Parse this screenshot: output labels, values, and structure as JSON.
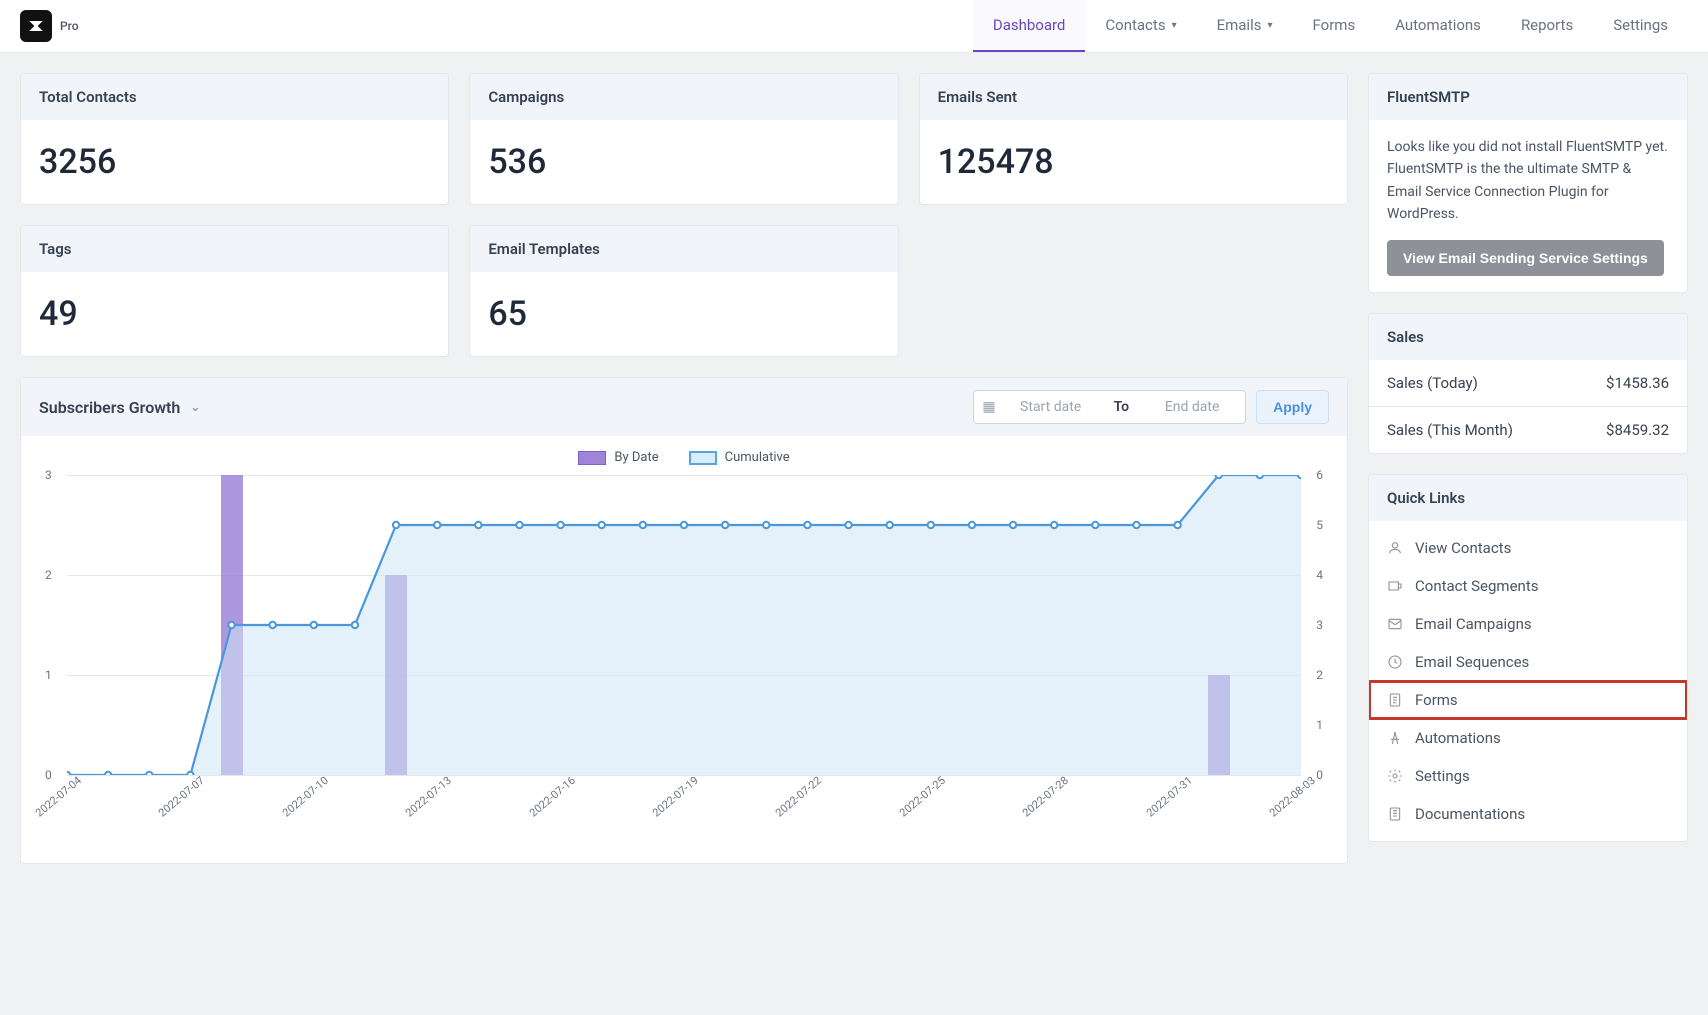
{
  "brand": {
    "badge": "Pro"
  },
  "nav": {
    "items": [
      {
        "label": "Dashboard",
        "active": true
      },
      {
        "label": "Contacts",
        "caret": true
      },
      {
        "label": "Emails",
        "caret": true
      },
      {
        "label": "Forms"
      },
      {
        "label": "Automations"
      },
      {
        "label": "Reports"
      },
      {
        "label": "Settings"
      }
    ]
  },
  "stats": {
    "total_contacts": {
      "label": "Total Contacts",
      "value": "3256"
    },
    "campaigns": {
      "label": "Campaigns",
      "value": "536"
    },
    "emails_sent": {
      "label": "Emails Sent",
      "value": "125478"
    },
    "tags": {
      "label": "Tags",
      "value": "49"
    },
    "email_templates": {
      "label": "Email Templates",
      "value": "65"
    }
  },
  "chart": {
    "title": "Subscribers Growth",
    "legend_bar": "By Date",
    "legend_line": "Cumulative",
    "date_start_ph": "Start date",
    "date_sep": "To",
    "date_end_ph": "End date",
    "apply": "Apply"
  },
  "fluentsmtp": {
    "title": "FluentSMTP",
    "text": "Looks like you did not install FluentSMTP yet. FluentSMTP is the the ultimate SMTP & Email Service Connection Plugin for WordPress.",
    "button": "View Email Sending Service Settings"
  },
  "sales": {
    "title": "Sales",
    "today_label": "Sales (Today)",
    "today_value": "$1458.36",
    "month_label": "Sales (This Month)",
    "month_value": "$8459.32"
  },
  "quicklinks": {
    "title": "Quick Links",
    "items": [
      {
        "label": "View Contacts"
      },
      {
        "label": "Contact Segments"
      },
      {
        "label": "Email Campaigns"
      },
      {
        "label": "Email Sequences"
      },
      {
        "label": "Forms",
        "highlight": true
      },
      {
        "label": "Automations"
      },
      {
        "label": "Settings"
      },
      {
        "label": "Documentations"
      }
    ]
  },
  "chart_data": {
    "type": "bar+line",
    "categories": [
      "2022-07-04",
      "2022-07-05",
      "2022-07-06",
      "2022-07-07",
      "2022-07-08",
      "2022-07-09",
      "2022-07-10",
      "2022-07-11",
      "2022-07-12",
      "2022-07-13",
      "2022-07-14",
      "2022-07-15",
      "2022-07-16",
      "2022-07-17",
      "2022-07-18",
      "2022-07-19",
      "2022-07-20",
      "2022-07-21",
      "2022-07-22",
      "2022-07-23",
      "2022-07-24",
      "2022-07-25",
      "2022-07-26",
      "2022-07-27",
      "2022-07-28",
      "2022-07-29",
      "2022-07-30",
      "2022-07-31",
      "2022-08-01",
      "2022-08-02",
      "2022-08-03"
    ],
    "series": [
      {
        "name": "By Date",
        "type": "bar",
        "axis": "left",
        "values": [
          0,
          0,
          0,
          0,
          3,
          0,
          0,
          0,
          2,
          0,
          0,
          0,
          0,
          0,
          0,
          0,
          0,
          0,
          0,
          0,
          0,
          0,
          0,
          0,
          0,
          0,
          0,
          0,
          1,
          0,
          0
        ]
      },
      {
        "name": "Cumulative",
        "type": "line",
        "axis": "right",
        "values": [
          0,
          0,
          0,
          0,
          3,
          3,
          3,
          3,
          5,
          5,
          5,
          5,
          5,
          5,
          5,
          5,
          5,
          5,
          5,
          5,
          5,
          5,
          5,
          5,
          5,
          5,
          5,
          5,
          6,
          6,
          6
        ]
      }
    ],
    "y_left": {
      "min": 0,
      "max": 3,
      "ticks": [
        0,
        1,
        2,
        3
      ]
    },
    "y_right": {
      "min": 0,
      "max": 6,
      "ticks": [
        0,
        1,
        2,
        3,
        4,
        5,
        6
      ]
    },
    "x_tick_labels": [
      {
        "label": "2022-07-04",
        "idx": 0
      },
      {
        "label": "2022-07-07",
        "idx": 3
      },
      {
        "label": "2022-07-10",
        "idx": 6
      },
      {
        "label": "2022-07-13",
        "idx": 9
      },
      {
        "label": "2022-07-16",
        "idx": 12
      },
      {
        "label": "2022-07-19",
        "idx": 15
      },
      {
        "label": "2022-07-22",
        "idx": 18
      },
      {
        "label": "2022-07-25",
        "idx": 21
      },
      {
        "label": "2022-07-28",
        "idx": 24
      },
      {
        "label": "2022-07-31",
        "idx": 27
      },
      {
        "label": "2022-08-03",
        "idx": 30
      }
    ]
  }
}
